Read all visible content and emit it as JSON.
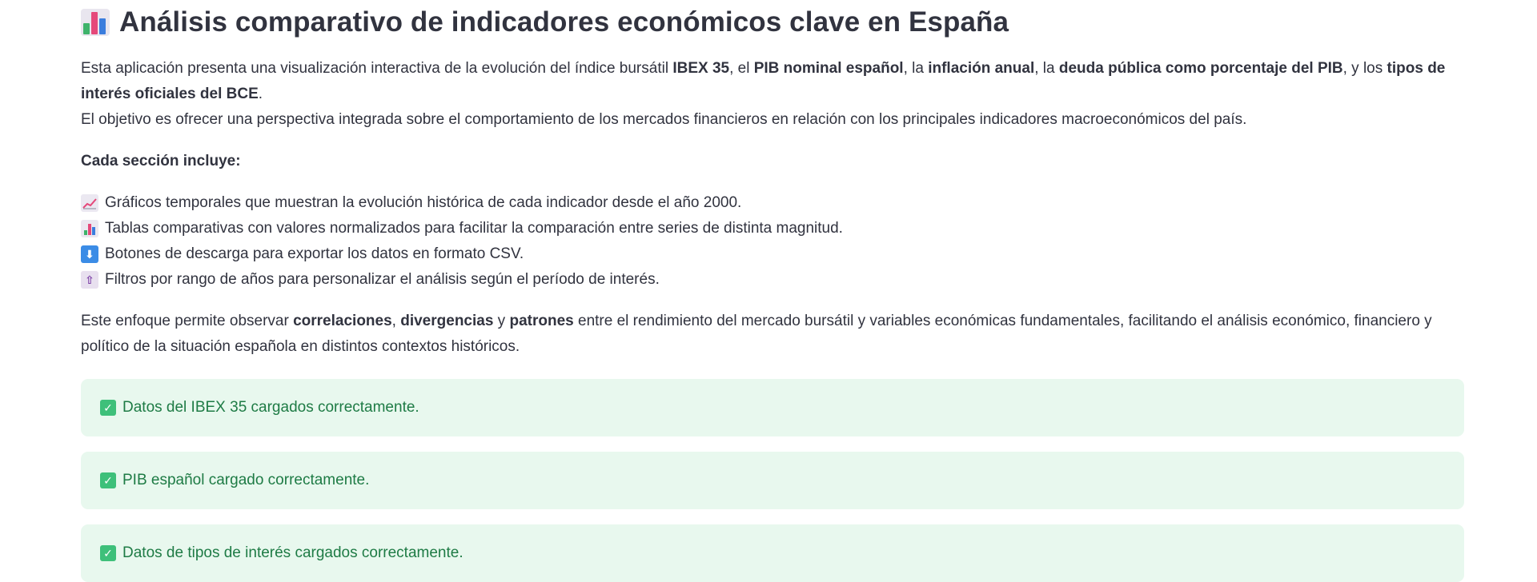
{
  "header": {
    "title": "Análisis comparativo de indicadores económicos clave en España",
    "icon": "bar-chart-icon"
  },
  "intro": {
    "t1": "Esta aplicación presenta una visualización interactiva de la evolución del índice bursátil ",
    "b1": "IBEX 35",
    "t2": ", el ",
    "b2": "PIB nominal español",
    "t3": ", la ",
    "b3": "inflación anual",
    "t4": ", la ",
    "b4": "deuda pública como porcentaje del PIB",
    "t5": ", y los ",
    "b5": "tipos de interés oficiales del BCE",
    "t6": "."
  },
  "objetivo": "El objetivo es ofrecer una perspectiva integrada sobre el comportamiento de los mercados financieros en relación con los principales indicadores macroeconómicos del país.",
  "sections_heading": "Cada sección incluye:",
  "features": [
    {
      "icon": "chart-increasing-icon",
      "text": "Gráficos temporales que muestran la evolución histórica de cada indicador desde el año 2000."
    },
    {
      "icon": "bar-chart-icon",
      "text": "Tablas comparativas con valores normalizados para facilitar la comparación entre series de distinta magnitud."
    },
    {
      "icon": "down-arrow-icon",
      "text": "Botones de descarga para exportar los datos en formato CSV."
    },
    {
      "icon": "filter-icon",
      "text": "Filtros por rango de años para personalizar el análisis según el período de interés."
    }
  ],
  "enfoque": {
    "t1": "Este enfoque permite observar ",
    "b1": "correlaciones",
    "t2": ", ",
    "b2": "divergencias",
    "t3": " y ",
    "b3": "patrones",
    "t4": " entre el rendimiento del mercado bursátil y variables económicas fundamentales, facilitando el análisis económico, financiero y político de la situación española en distintos contextos históricos."
  },
  "alerts": [
    {
      "icon": "check-mark-icon",
      "text": "Datos del IBEX 35 cargados correctamente."
    },
    {
      "icon": "check-mark-icon",
      "text": "PIB español cargado correctamente."
    },
    {
      "icon": "check-mark-icon",
      "text": "Datos de tipos de interés cargados correctamente."
    }
  ],
  "colors": {
    "text": "#31333f",
    "success_bg": "#e8f8ee",
    "success_text": "#1e7b45",
    "check_green": "#3ec07a"
  }
}
